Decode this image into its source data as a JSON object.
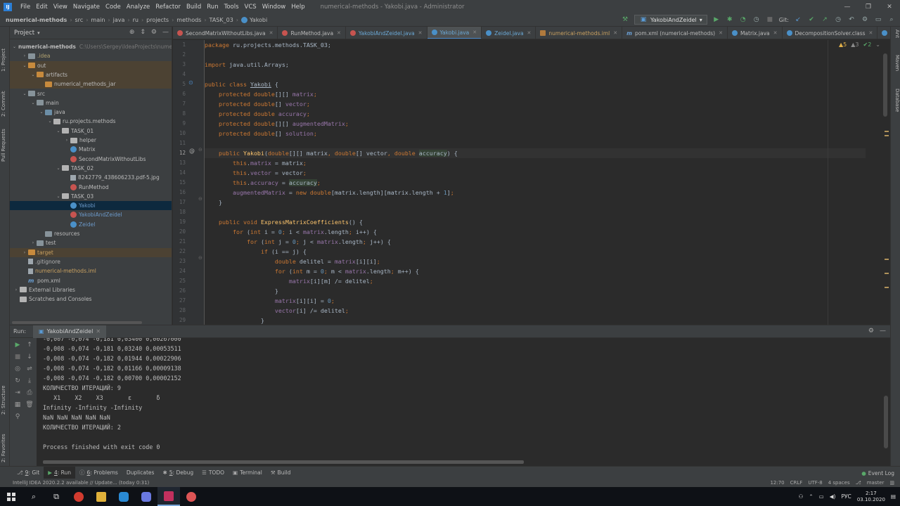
{
  "menubar": {
    "logo": "IJ",
    "items": [
      "File",
      "Edit",
      "View",
      "Navigate",
      "Code",
      "Analyze",
      "Refactor",
      "Build",
      "Run",
      "Tools",
      "VCS",
      "Window",
      "Help"
    ],
    "window_title": "numerical-methods - Yakobi.java - Administrator",
    "controls": [
      "—",
      "❐",
      "✕"
    ]
  },
  "navbar": {
    "breadcrumbs": [
      "numerical-methods",
      "src",
      "main",
      "java",
      "ru",
      "projects",
      "methods",
      "TASK_03",
      "Yakobi"
    ],
    "run_config": "YakobiAndZeidel",
    "git_label": "Git:"
  },
  "left_stripe": {
    "tabs": [
      "1: Project",
      "2: Commit",
      "Pull Requests",
      "2: Structure",
      "2: Favorites"
    ]
  },
  "right_stripe": {
    "tabs": [
      "Ant",
      "Maven",
      "Database"
    ]
  },
  "project": {
    "title": "Project",
    "tree": [
      {
        "label": "numerical-methods",
        "extra": "C:\\Users\\Sergey\\IdeaProjects\\numer",
        "depth": 0,
        "arrow": "⌄",
        "icon": "folder",
        "bold": true
      },
      {
        "label": ".idea",
        "depth": 1,
        "arrow": "›",
        "icon": "folder",
        "style": "idea"
      },
      {
        "label": "out",
        "depth": 1,
        "arrow": "⌄",
        "icon": "folder-o",
        "hl": true
      },
      {
        "label": "artifacts",
        "depth": 2,
        "arrow": "⌄",
        "icon": "folder-o",
        "hl": true
      },
      {
        "label": "numerical_methods_jar",
        "depth": 3,
        "arrow": "",
        "icon": "folder-o",
        "hl": true
      },
      {
        "label": "src",
        "depth": 1,
        "arrow": "⌄",
        "icon": "folder"
      },
      {
        "label": "main",
        "depth": 2,
        "arrow": "⌄",
        "icon": "folder"
      },
      {
        "label": "java",
        "depth": 3,
        "arrow": "⌄",
        "icon": "folder-src"
      },
      {
        "label": "ru.projects.methods",
        "depth": 4,
        "arrow": "⌄",
        "icon": "folder-pkg"
      },
      {
        "label": "TASK_01",
        "depth": 5,
        "arrow": "⌄",
        "icon": "folder-pkg"
      },
      {
        "label": "helper",
        "depth": 6,
        "arrow": "›",
        "icon": "folder-pkg"
      },
      {
        "label": "Matrix",
        "depth": 6,
        "arrow": "",
        "icon": "cls"
      },
      {
        "label": "SecondMatrixWithoutLibs",
        "depth": 6,
        "arrow": "",
        "icon": "cls-res"
      },
      {
        "label": "TASK_02",
        "depth": 5,
        "arrow": "⌄",
        "icon": "folder-pkg"
      },
      {
        "label": "8242779_438606233.pdf-5.jpg",
        "depth": 6,
        "arrow": "",
        "icon": "jpg"
      },
      {
        "label": "RunMethod",
        "depth": 6,
        "arrow": "",
        "icon": "cls-res"
      },
      {
        "label": "TASK_03",
        "depth": 5,
        "arrow": "⌄",
        "icon": "folder-pkg"
      },
      {
        "label": "Yakobi",
        "depth": 6,
        "arrow": "",
        "icon": "cls",
        "sel": true,
        "style": "cls"
      },
      {
        "label": "YakobiAndZeidel",
        "depth": 6,
        "arrow": "",
        "icon": "cls-res",
        "style": "cls"
      },
      {
        "label": "Zeidel",
        "depth": 6,
        "arrow": "",
        "icon": "cls",
        "style": "cls"
      },
      {
        "label": "resources",
        "depth": 3,
        "arrow": "",
        "icon": "folder"
      },
      {
        "label": "test",
        "depth": 2,
        "arrow": "›",
        "icon": "folder"
      },
      {
        "label": "target",
        "depth": 1,
        "arrow": "›",
        "icon": "folder-o",
        "hl": true,
        "style": "orange"
      },
      {
        "label": ".gitignore",
        "depth": 1,
        "arrow": "",
        "icon": "file",
        "style": "ign"
      },
      {
        "label": "numerical-methods.iml",
        "depth": 1,
        "arrow": "",
        "icon": "file",
        "style": "orange"
      },
      {
        "label": "pom.xml",
        "depth": 1,
        "arrow": "",
        "icon": "mvn"
      },
      {
        "label": "External Libraries",
        "depth": 0,
        "arrow": "›",
        "icon": "folder-pkg"
      },
      {
        "label": "Scratches and Consoles",
        "depth": 0,
        "arrow": "",
        "icon": "folder-pkg"
      }
    ]
  },
  "editor": {
    "tabs": [
      {
        "label": "SecondMatrixWithoutLibs.java",
        "icon": "res"
      },
      {
        "label": "RunMethod.java",
        "icon": "res"
      },
      {
        "label": "YakobiAndZeidel.java",
        "icon": "res",
        "hi": true
      },
      {
        "label": "Yakobi.java",
        "icon": "cls",
        "active": true,
        "hi": true
      },
      {
        "label": "Zeidel.java",
        "icon": "cls",
        "hi": true
      },
      {
        "label": "numerical-methods.iml",
        "icon": "xml",
        "orange": true
      },
      {
        "label": "pom.xml (numerical-methods)",
        "icon": "mvn"
      },
      {
        "label": "Matrix.java",
        "icon": "cls"
      },
      {
        "label": "DecompositionSolver.class",
        "icon": "cls"
      },
      {
        "label": "LUDecomp",
        "icon": "cls"
      }
    ],
    "inspections": {
      "warnings": "▲5",
      "weak": "▲3",
      "ok": "✔2"
    },
    "current_line": 12,
    "line_numbers": [
      "1",
      "2",
      "3",
      "4",
      "5",
      "6",
      "7",
      "8",
      "9",
      "10",
      "11",
      "12",
      "13",
      "14",
      "15",
      "16",
      "17",
      "18",
      "19",
      "20",
      "21",
      "22",
      "23",
      "24",
      "25",
      "26",
      "27",
      "28",
      "29"
    ],
    "lines": [
      [
        [
          "kw",
          "package "
        ],
        [
          "pkg",
          "ru.projects.methods.TASK_03"
        ],
        [
          "",
          "; "
        ]
      ],
      [],
      [
        [
          "kw",
          "import "
        ],
        [
          "",
          "java.util.Arrays;"
        ]
      ],
      [],
      [
        [
          "kw",
          "public class "
        ],
        [
          "cn",
          "Yakobi"
        ],
        [
          "",
          " {"
        ]
      ],
      [
        [
          "",
          "    "
        ],
        [
          "kw",
          "protected double"
        ],
        [
          "",
          "[][] "
        ],
        [
          "fld",
          "matrix"
        ],
        [
          "kw",
          ";"
        ]
      ],
      [
        [
          "",
          "    "
        ],
        [
          "kw",
          "protected double"
        ],
        [
          "",
          "[] "
        ],
        [
          "fld",
          "vector"
        ],
        [
          "kw",
          ";"
        ]
      ],
      [
        [
          "",
          "    "
        ],
        [
          "kw",
          "protected double "
        ],
        [
          "fld",
          "accuracy"
        ],
        [
          "kw",
          ";"
        ]
      ],
      [
        [
          "",
          "    "
        ],
        [
          "kw",
          "protected double"
        ],
        [
          "",
          "[][] "
        ],
        [
          "fld",
          "augmentedMatrix"
        ],
        [
          "kw",
          ";"
        ]
      ],
      [
        [
          "",
          "    "
        ],
        [
          "kw",
          "protected double"
        ],
        [
          "",
          "[] "
        ],
        [
          "fld",
          "solution"
        ],
        [
          "kw",
          ";"
        ]
      ],
      [],
      [
        [
          "",
          "    "
        ],
        [
          "kw",
          "public "
        ],
        [
          "fn",
          "Yakobi"
        ],
        [
          "",
          "("
        ],
        [
          "kw",
          "double"
        ],
        [
          "",
          "[][] matrix"
        ],
        [
          "kw",
          ", "
        ],
        [
          "kw",
          "double"
        ],
        [
          "",
          "[] vector"
        ],
        [
          "kw",
          ", "
        ],
        [
          "kw",
          "double "
        ],
        [
          "ac",
          "accuracy"
        ],
        [
          "",
          ") {"
        ]
      ],
      [
        [
          "",
          "        "
        ],
        [
          "kw",
          "this"
        ],
        [
          "",
          "."
        ],
        [
          "fld",
          "matrix"
        ],
        [
          "",
          " = matrix"
        ],
        [
          "kw",
          ";"
        ]
      ],
      [
        [
          "",
          "        "
        ],
        [
          "kw",
          "this"
        ],
        [
          "",
          "."
        ],
        [
          "fld",
          "vector"
        ],
        [
          "",
          " = vector"
        ],
        [
          "kw",
          ";"
        ]
      ],
      [
        [
          "",
          "        "
        ],
        [
          "kw",
          "this"
        ],
        [
          "",
          "."
        ],
        [
          "fld",
          "accuracy"
        ],
        [
          "",
          " = "
        ],
        [
          "ac",
          "accuracy"
        ],
        [
          "kw",
          ";"
        ]
      ],
      [
        [
          "",
          "        "
        ],
        [
          "fld",
          "augmentedMatrix"
        ],
        [
          "",
          " = "
        ],
        [
          "kw",
          "new double"
        ],
        [
          "",
          "["
        ],
        [
          "",
          "matrix.length][matrix.length + "
        ],
        [
          "num",
          "1"
        ],
        [
          "",
          "]"
        ],
        [
          "kw",
          ";"
        ]
      ],
      [
        [
          "",
          "    }"
        ]
      ],
      [],
      [
        [
          "",
          "    "
        ],
        [
          "kw",
          "public void "
        ],
        [
          "fn",
          "ExpressMatrixCoefficients"
        ],
        [
          "",
          "() {"
        ]
      ],
      [
        [
          "",
          "        "
        ],
        [
          "kw",
          "for "
        ],
        [
          "",
          "("
        ],
        [
          "kw",
          "int "
        ],
        [
          "",
          "i = "
        ],
        [
          "num",
          "0"
        ],
        [
          "kw",
          "; "
        ],
        [
          "",
          "i < "
        ],
        [
          "fld",
          "matrix"
        ],
        [
          "",
          ".length"
        ],
        [
          "kw",
          "; "
        ],
        [
          "",
          "i++) {"
        ]
      ],
      [
        [
          "",
          "            "
        ],
        [
          "kw",
          "for "
        ],
        [
          "",
          "("
        ],
        [
          "kw",
          "int "
        ],
        [
          "",
          "j = "
        ],
        [
          "num",
          "0"
        ],
        [
          "kw",
          "; "
        ],
        [
          "",
          "j < "
        ],
        [
          "fld",
          "matrix"
        ],
        [
          "",
          ".length"
        ],
        [
          "kw",
          "; "
        ],
        [
          "",
          "j++) {"
        ]
      ],
      [
        [
          "",
          "                "
        ],
        [
          "kw",
          "if "
        ],
        [
          "",
          "(i == j) {"
        ]
      ],
      [
        [
          "",
          "                    "
        ],
        [
          "kw",
          "double "
        ],
        [
          "",
          "delitel = "
        ],
        [
          "fld",
          "matrix"
        ],
        [
          "",
          "[i][i]"
        ],
        [
          "kw",
          ";"
        ]
      ],
      [
        [
          "",
          "                    "
        ],
        [
          "kw",
          "for "
        ],
        [
          "",
          "("
        ],
        [
          "kw",
          "int "
        ],
        [
          "",
          "m = "
        ],
        [
          "num",
          "0"
        ],
        [
          "kw",
          "; "
        ],
        [
          "",
          "m < "
        ],
        [
          "fld",
          "matrix"
        ],
        [
          "",
          ".length"
        ],
        [
          "kw",
          "; "
        ],
        [
          "",
          "m++) {"
        ]
      ],
      [
        [
          "",
          "                        "
        ],
        [
          "fld",
          "matrix"
        ],
        [
          "",
          "[i][m] /= delitel"
        ],
        [
          "kw",
          ";"
        ]
      ],
      [
        [
          "",
          "                    }"
        ]
      ],
      [
        [
          "",
          "                    "
        ],
        [
          "fld",
          "matrix"
        ],
        [
          "",
          "[i][i] = "
        ],
        [
          "num",
          "0"
        ],
        [
          "kw",
          ";"
        ]
      ],
      [
        [
          "",
          "                    "
        ],
        [
          "fld",
          "vector"
        ],
        [
          "",
          "[i] /= delitel"
        ],
        [
          "kw",
          ";"
        ]
      ],
      [
        [
          "",
          "                }"
        ]
      ]
    ]
  },
  "run": {
    "label": "Run:",
    "tab": "YakobiAndZeidel",
    "console": [
      "-0,007 -0,074 -0,181 0,03400 0,00267000",
      "-0,008 -0,074 -0,181 0,03240 0,00053511",
      "-0,008 -0,074 -0,182 0,01944 0,00022906",
      "-0,008 -0,074 -0,182 0,01166 0,00009138",
      "-0,008 -0,074 -0,182 0,00700 0,00002152",
      "КОЛИЧЕСТВО ИТЕРАЦИЙ: 9",
      "   X1    X2    X3       ε       δ",
      "Infinity -Infinity -Infinity",
      "NaN NaN NaN NaN NaN",
      "КОЛИЧЕСТВО ИТЕРАЦИЙ: 2",
      "",
      "Process finished with exit code 0"
    ]
  },
  "bottom_tabs": [
    {
      "num": "9",
      "label": ": Git",
      "icon": "⎇"
    },
    {
      "num": "4",
      "label": ": Run",
      "icon": "▶",
      "active": true
    },
    {
      "num": "6",
      "label": ": Problems",
      "icon": "ⓘ"
    },
    {
      "num": "",
      "label": "Duplicates",
      "icon": ""
    },
    {
      "num": "5",
      "label": ": Debug",
      "icon": "✱"
    },
    {
      "num": "",
      "label": "TODO",
      "icon": "☰"
    },
    {
      "num": "",
      "label": "Terminal",
      "icon": "▣"
    },
    {
      "num": "",
      "label": "Build",
      "icon": "⚒"
    }
  ],
  "event_log": "Event Log",
  "status": {
    "message": "IntelliJ IDEA 2020.2.2 available // Update... (today 0:31)",
    "position": "12:70",
    "line_sep": "CRLF",
    "encoding": "UTF-8",
    "indent": "4 spaces",
    "branch": "master"
  },
  "taskbar": {
    "lang": "РУС",
    "time": "2:17",
    "date": "03.10.2020"
  }
}
